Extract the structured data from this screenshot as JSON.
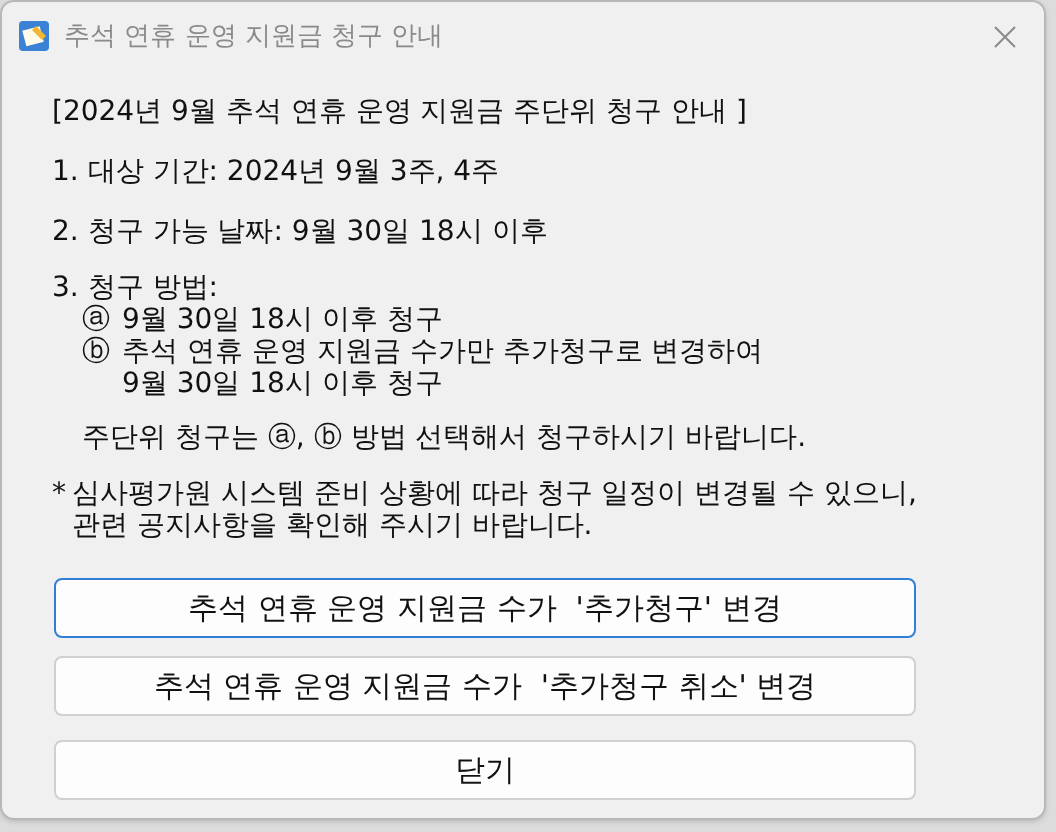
{
  "window": {
    "title": "추석 연휴 운영 지원금 청구 안내"
  },
  "paragraphs": [
    {
      "lines": [
        "[2024년 9월 추석 연휴 운영 지원금 주단위 청구 안내 ]"
      ]
    },
    {
      "lines": [
        "1. 대상 기간: 2024년 9월 3주, 4주"
      ]
    },
    {
      "lines": [
        "2. 청구 가능 날짜: 9월 30일 18시 이후"
      ]
    },
    {
      "lines": [
        "3. 청구 방법:"
      ],
      "items": [
        {
          "marker": "ⓐ",
          "lines": [
            "9월 30일 18시 이후 청구"
          ]
        },
        {
          "marker": "ⓑ",
          "lines": [
            "추석 연휴 운영 지원금 수가만 추가청구로 변경하여",
            "9월 30일 18시 이후 청구"
          ]
        }
      ],
      "note": "주단위 청구는 ⓐ, ⓑ 방법 선택해서 청구하시기 바랍니다."
    },
    {
      "marker": "*",
      "lines": [
        "심사평가원 시스템 준비 상황에 따라 청구 일정이 변경될 수 있으니,",
        "관련 공지사항을 확인해 주시기 바랍니다."
      ]
    }
  ],
  "buttons": [
    {
      "label": "추석 연휴 운영 지원금 수가  '추가청구' 변경",
      "focused": true
    },
    {
      "label": "추석 연휴 운영 지원금 수가  '추가청구 취소' 변경",
      "focused": false
    },
    {
      "label": "닫기",
      "focused": false
    }
  ]
}
